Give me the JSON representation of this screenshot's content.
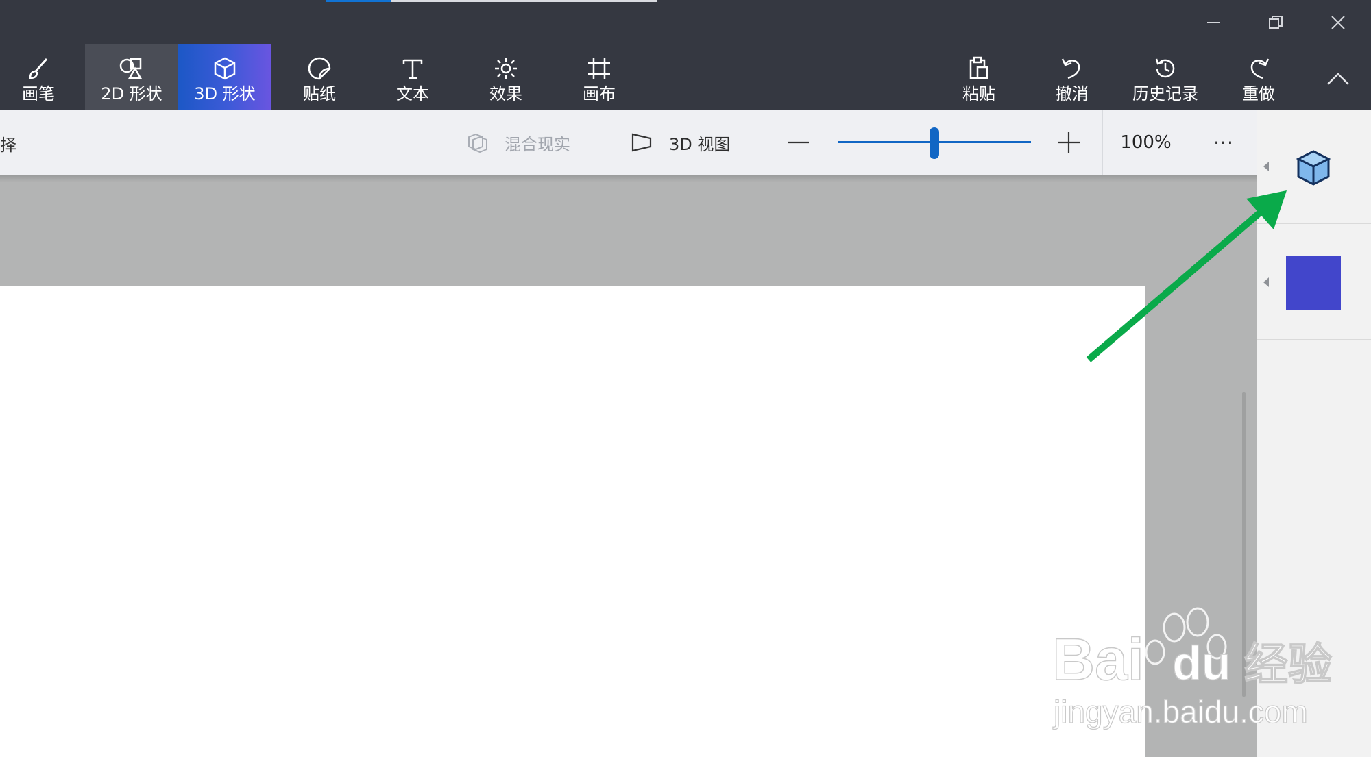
{
  "window": {
    "minimize_icon": "minimize-icon",
    "restore_icon": "restore-icon",
    "close_icon": "close-icon"
  },
  "toolbar": {
    "tools": [
      {
        "id": "brush",
        "label": "画笔",
        "icon": "brush-icon"
      },
      {
        "id": "2d",
        "label": "2D 形状",
        "icon": "2d-shapes-icon"
      },
      {
        "id": "3d",
        "label": "3D 形状",
        "icon": "3d-cube-icon"
      },
      {
        "id": "sticker",
        "label": "贴纸",
        "icon": "sticker-icon"
      },
      {
        "id": "text",
        "label": "文本",
        "icon": "text-icon"
      },
      {
        "id": "effects",
        "label": "效果",
        "icon": "sun-icon"
      },
      {
        "id": "canvas",
        "label": "画布",
        "icon": "crop-icon"
      }
    ],
    "actions": [
      {
        "id": "paste",
        "label": "粘贴",
        "icon": "clipboard-icon"
      },
      {
        "id": "undo",
        "label": "撤消",
        "icon": "undo-icon"
      },
      {
        "id": "history",
        "label": "历史记录",
        "icon": "history-icon"
      },
      {
        "id": "redo",
        "label": "重做",
        "icon": "redo-icon"
      }
    ],
    "collapse_icon": "chevron-up-icon",
    "selected_tool": "3D 形状"
  },
  "subbar": {
    "left_fragment": "择",
    "mixed_reality_label": "混合现实",
    "view3d_label": "3D 视图",
    "zoom": {
      "value_text": "100%",
      "slider_level": 0.5
    },
    "more_label": "···"
  },
  "right_panel": {
    "cube_icon": "3d-cube-icon",
    "swatch_color": "#4246cb"
  },
  "colors": {
    "ribbon": "#353841",
    "accent": "#1166c4",
    "arrow": "#0aaa4a",
    "canvas": "#ffffff",
    "workspace": "#b3b4b4"
  },
  "watermark": {
    "brand": "Bai du 经验",
    "url": "jingyan.baidu.com"
  }
}
